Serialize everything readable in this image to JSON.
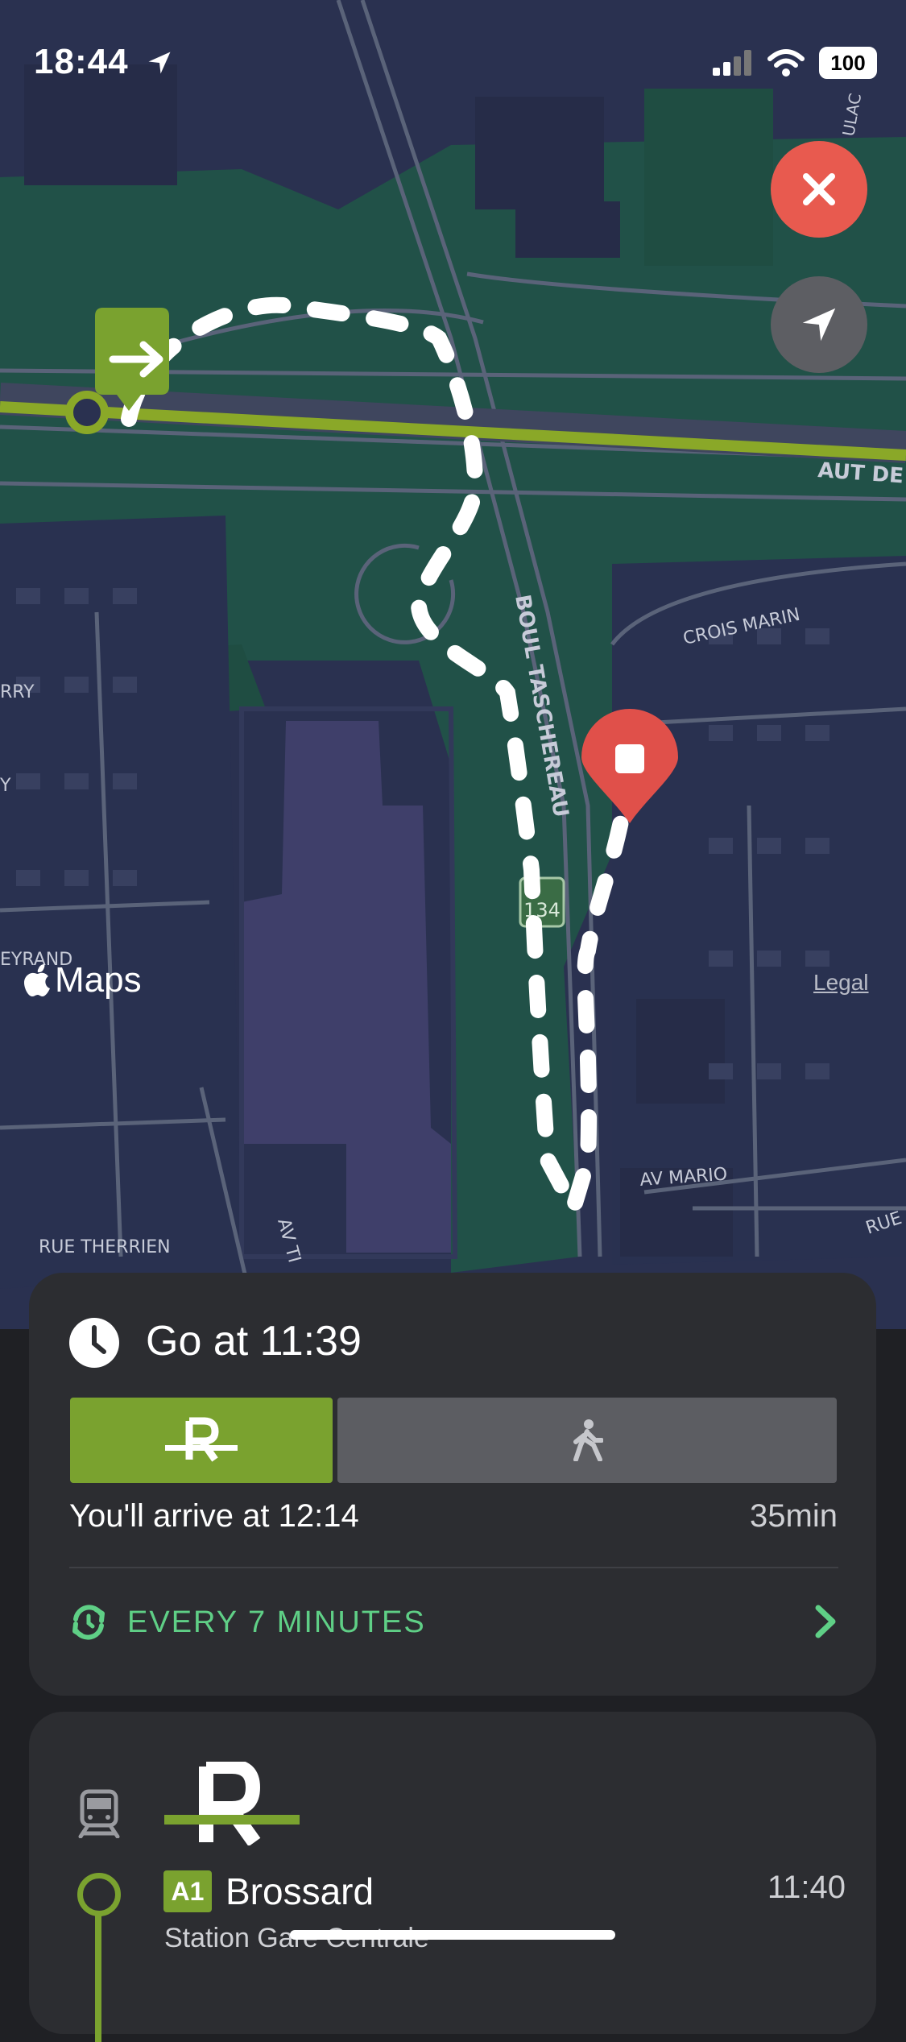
{
  "status_bar": {
    "time": "18:44",
    "battery": "100"
  },
  "map": {
    "road_labels": {
      "highway": "AUT DE",
      "boulevard": "BOUL TASCHEREAU",
      "crois_marin": "CROIS MARIN",
      "av_mario": "AV MARIO",
      "rue_therrien": "RUE THERRIEN",
      "rue_right": "RUE",
      "ulac": "ULAC",
      "rry": "RRY",
      "y": "Y",
      "eyrand": "EYRAND",
      "av_ti": "AV TI"
    },
    "route_shield": "134",
    "maps_label": "Maps",
    "legal_label": "Legal"
  },
  "trip_card": {
    "go_at": "Go at 11:39",
    "arrive": "You'll arrive at 12:14",
    "duration": "35min",
    "frequency": "EVERY 7 MINUTES"
  },
  "line_card": {
    "badge": "A1",
    "stop_name": "Brossard",
    "stop_time": "11:40",
    "stop_sub": "Station Gare Centrale"
  },
  "colors": {
    "accent_green": "#7aa22f",
    "frequency_green": "#5fcf86",
    "close_red": "#e85a4f",
    "card_bg": "#2c2d31"
  }
}
